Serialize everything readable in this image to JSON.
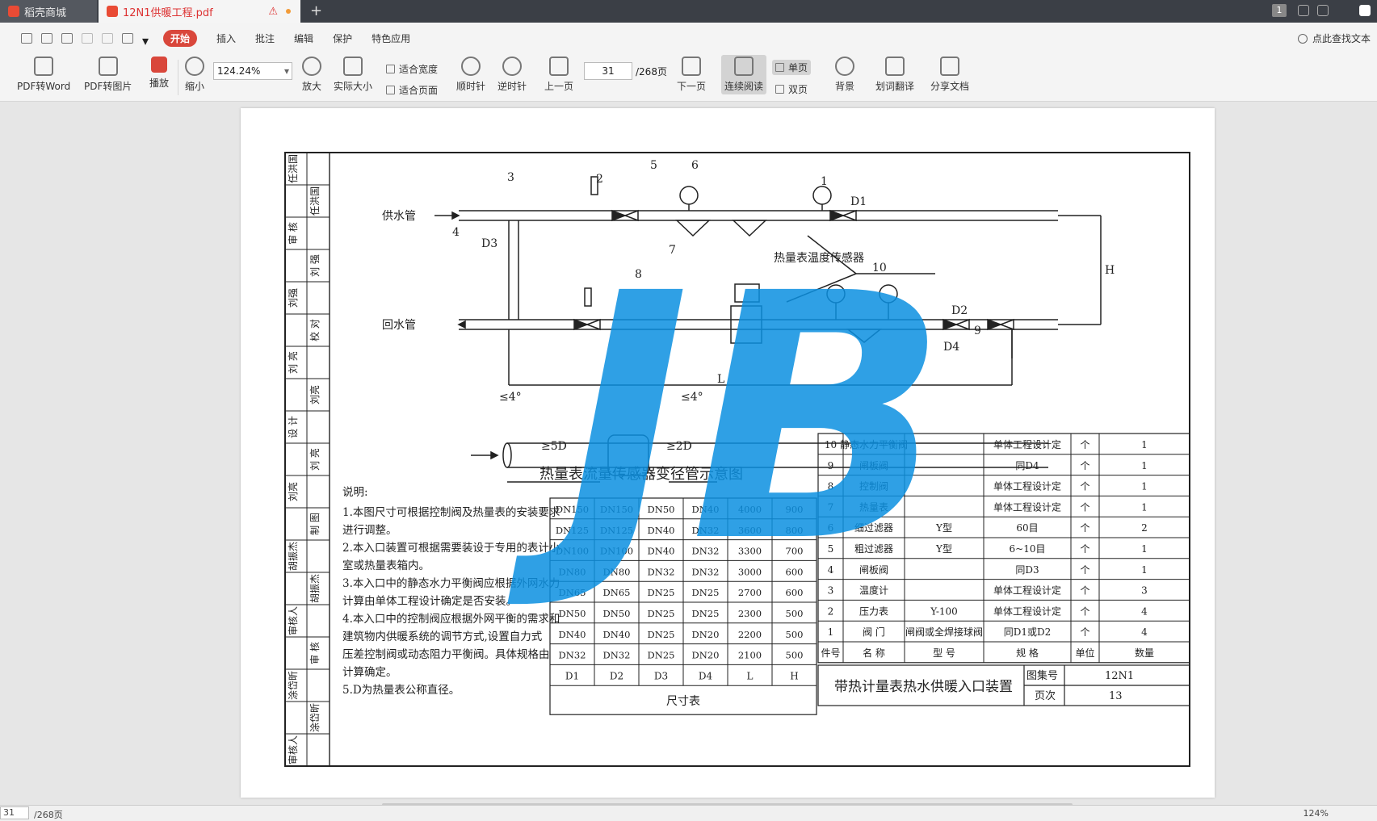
{
  "tabs": [
    {
      "label": "稻壳商城"
    },
    {
      "label": "12N1供暖工程.pdf"
    }
  ],
  "title_icons": {
    "page_count_badge": "1",
    "warning_symbol": "⚠"
  },
  "menu": {
    "items": [
      "开始",
      "插入",
      "批注",
      "编辑",
      "保护",
      "特色应用"
    ],
    "active": "开始",
    "search_hint": "点此查找文本"
  },
  "toolbar": {
    "pdf_to_word": "PDF转Word",
    "pdf_to_image": "PDF转图片",
    "play": "播放",
    "zoom_out": "缩小",
    "zoom_value": "124.24%",
    "zoom_in": "放大",
    "actual_size": "实际大小",
    "fit_width": "适合宽度",
    "fit_page": "适合页面",
    "rotate_cw": "顺时针",
    "rotate_ccw": "逆时针",
    "prev_page": "上一页",
    "current_page": "31",
    "total_pages": "/268页",
    "next_page": "下一页",
    "continuous": "连续阅读",
    "single_page": "单页",
    "double_page": "双页",
    "background": "背景",
    "translate": "划词翻译",
    "share": "分享文档"
  },
  "status": {
    "page": "31",
    "total": "/268页",
    "zoom": "124%"
  },
  "colors": {
    "accent": "#d9473b",
    "watermark": "#0a8fe0",
    "ink": "#222222"
  },
  "drawing": {
    "supply_label": "供水管",
    "return_label": "回水管",
    "sensor_label": "热量表温度传感器",
    "d1": "D1",
    "d2": "D2",
    "d3": "D3",
    "d4": "D4",
    "h": "H",
    "l": "L",
    "callouts": [
      "1",
      "2",
      "3",
      "4",
      "5",
      "6",
      "7",
      "8",
      "9",
      "10"
    ],
    "angle": "≤4°",
    "len_5d": "≥5D",
    "len_2d": "≥2D",
    "transition_title": "热量表流量传感器变径管示意图",
    "watermark_small": "JB",
    "watermark": "JB",
    "notes_title": "说明:",
    "notes": [
      "1.本图尺寸可根据控制阀及热量表的安装要求",
      "   进行调整。",
      "2.本入口装置可根据需要装设于专用的表计小",
      "   室或热量表箱内。",
      "3.本入口中的静态水力平衡阀应根据外网水力",
      "   计算由单体工程设计确定是否安装。",
      "4.本入口中的控制阀应根据外网平衡的需求和",
      "   建筑物内供暖系统的调节方式,设置自力式",
      "   压差控制阀或动态阻力平衡阀。具体规格由",
      "   计算确定。",
      "5.D为热量表公称直径。"
    ],
    "dim_table": {
      "rows": [
        [
          "DN150",
          "DN150",
          "DN50",
          "DN40",
          "4000",
          "900"
        ],
        [
          "DN125",
          "DN125",
          "DN40",
          "DN32",
          "3600",
          "800"
        ],
        [
          "DN100",
          "DN100",
          "DN40",
          "DN32",
          "3300",
          "700"
        ],
        [
          "DN80",
          "DN80",
          "DN32",
          "DN32",
          "3000",
          "600"
        ],
        [
          "DN65",
          "DN65",
          "DN25",
          "DN25",
          "2700",
          "600"
        ],
        [
          "DN50",
          "DN50",
          "DN25",
          "DN25",
          "2300",
          "500"
        ],
        [
          "DN40",
          "DN40",
          "DN25",
          "DN20",
          "2200",
          "500"
        ],
        [
          "DN32",
          "DN32",
          "DN25",
          "DN20",
          "2100",
          "500"
        ]
      ],
      "header": [
        "D1",
        "D2",
        "D3",
        "D4",
        "L",
        "H"
      ],
      "caption": "尺寸表"
    },
    "parts_table": {
      "rows": [
        [
          "10",
          "静态水力平衡阀",
          "",
          "单体工程设计定",
          "个",
          "1"
        ],
        [
          "9",
          "闸板阀",
          "",
          "同D4",
          "个",
          "1"
        ],
        [
          "8",
          "控制阀",
          "",
          "单体工程设计定",
          "个",
          "1"
        ],
        [
          "7",
          "热量表",
          "",
          "单体工程设计定",
          "个",
          "1"
        ],
        [
          "6",
          "细过滤器",
          "Y型",
          "60目",
          "个",
          "2"
        ],
        [
          "5",
          "粗过滤器",
          "Y型",
          "6~10目",
          "个",
          "1"
        ],
        [
          "4",
          "闸板阀",
          "",
          "同D3",
          "个",
          "1"
        ],
        [
          "3",
          "温度计",
          "",
          "单体工程设计定",
          "个",
          "3"
        ],
        [
          "2",
          "压力表",
          "Y-100",
          "单体工程设计定",
          "个",
          "4"
        ],
        [
          "1",
          "阀 门",
          "闸阀或全焊接球阀",
          "同D1或D2",
          "个",
          "4"
        ]
      ],
      "header": [
        "件号",
        "名 称",
        "型 号",
        "规 格",
        "单位",
        "数量"
      ]
    },
    "title_block": {
      "title": "带热计量表热水供暖入口装置",
      "atlas_label": "图集号",
      "atlas_value": "12N1",
      "page_label": "页次",
      "page_value": "13"
    },
    "sidebar": [
      "任洪国",
      "任洪国",
      "审 核",
      "刘 强",
      "刘强",
      "校 对",
      "刘 亮",
      "刘亮",
      "设 计",
      "刘 亮",
      "刘亮",
      "制 图",
      "胡振杰",
      "胡振杰",
      "审核人",
      "审 核",
      "涂岱昕",
      "涂岱昕",
      "审核人"
    ]
  }
}
